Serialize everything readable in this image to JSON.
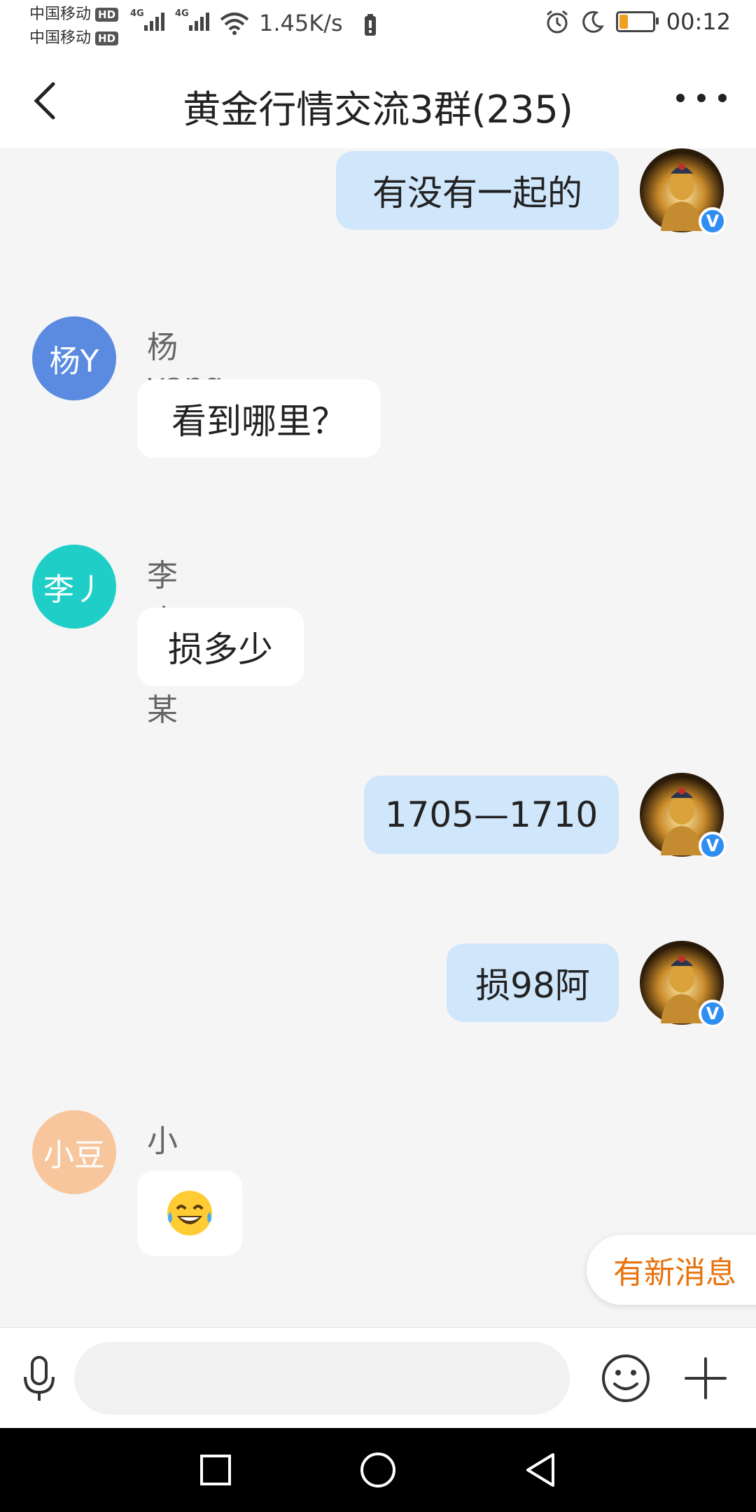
{
  "status_bar": {
    "carrier1": "中国移动",
    "carrier2": "中国移动",
    "hd_label": "HD",
    "network1": "4G",
    "network2": "4G",
    "speed": "1.45K/s",
    "time": "00:12",
    "battery_level": 0.2,
    "battery_color": "#f0a020"
  },
  "header": {
    "title": "黄金行情交流3群(235)",
    "back_icon": "chevron-left-icon",
    "more_icon": "more-dots-icon"
  },
  "messages": [
    {
      "direction": "out",
      "text": "有没有一起的",
      "verified_badge": "V"
    },
    {
      "direction": "in",
      "sender": "杨yang",
      "avatar_text": "杨Y",
      "avatar_color": "#5a8be0",
      "text": "看到哪里？"
    },
    {
      "direction": "in",
      "sender": "李丿某某",
      "avatar_text": "李丿",
      "avatar_color": "#1fcfc7",
      "text": "损多少"
    },
    {
      "direction": "out",
      "text": "1705—1710",
      "verified_badge": "V"
    },
    {
      "direction": "out",
      "text": "损98阿",
      "verified_badge": "V"
    },
    {
      "direction": "in",
      "sender": "小豆包",
      "avatar_text": "小豆",
      "avatar_color": "#f8c69c",
      "text": "😂",
      "emoji_name": "tears-of-joy-emoji"
    }
  ],
  "new_message_badge": "有新消息",
  "input_bar": {
    "input_value": "",
    "mic_icon": "microphone-icon",
    "emoji_icon": "smiley-icon",
    "plus_icon": "plus-icon"
  },
  "colors": {
    "outgoing_bubble": "#cfe6fb",
    "incoming_bubble": "#ffffff",
    "accent_orange": "#e8730e",
    "verified_blue": "#2f8ff0"
  },
  "nav_bar": {
    "recent_icon": "square-icon",
    "home_icon": "circle-icon",
    "back_icon": "triangle-back-icon"
  }
}
